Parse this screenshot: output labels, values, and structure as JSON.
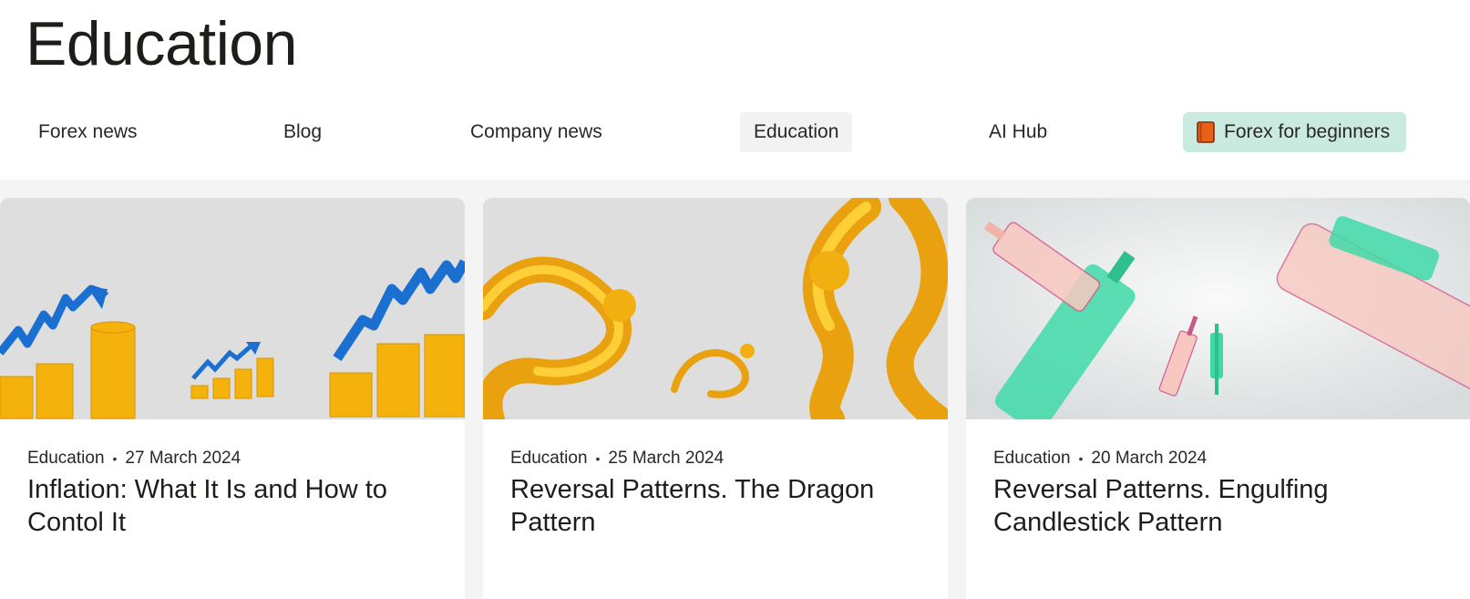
{
  "page": {
    "title": "Education"
  },
  "nav": {
    "items": [
      {
        "label": "Forex news"
      },
      {
        "label": "Blog"
      },
      {
        "label": "Company news"
      },
      {
        "label": "Education",
        "active": true
      },
      {
        "label": "AI Hub"
      }
    ],
    "cta": {
      "label": "Forex for beginners",
      "icon": "book-icon",
      "background": "#c9eadf"
    }
  },
  "cards": [
    {
      "category": "Education",
      "date": "27 March 2024",
      "title": "Inflation: What It Is and How to Contol It",
      "image": "gold-coins-rising-arrows"
    },
    {
      "category": "Education",
      "date": "25 March 2024",
      "title": "Reversal Patterns. The Dragon Pattern",
      "image": "golden-dragons"
    },
    {
      "category": "Education",
      "date": "20 March 2024",
      "title": "Reversal Patterns. Engulfing Candlestick Pattern",
      "image": "glass-candlesticks"
    }
  ],
  "colors": {
    "accent_cta": "#c9eadf",
    "active_tab": "#f2f2f2",
    "section_bg": "#f4f4f4"
  }
}
